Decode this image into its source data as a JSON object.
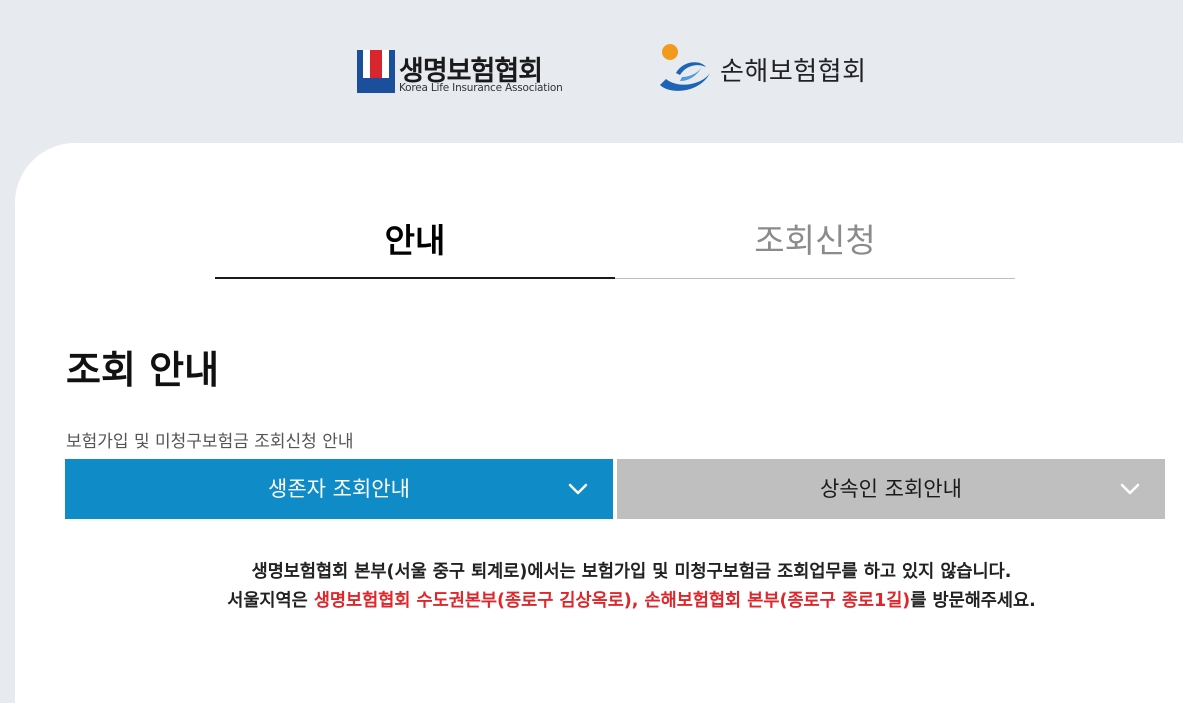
{
  "header": {
    "life_association": {
      "name": "생명보험협회",
      "subtitle": "Korea Life Insurance Association",
      "colors": {
        "blue": "#1b4e9b",
        "red": "#d7262e"
      }
    },
    "general_association": {
      "name": "손해보험협회",
      "colors": {
        "blue": "#1d64b4",
        "orange": "#f29a1c"
      }
    }
  },
  "tabs": [
    {
      "label": "안내",
      "active": true
    },
    {
      "label": "조회신청",
      "active": false
    }
  ],
  "main": {
    "title": "조회 안내",
    "subtitle": "보험가입 및 미청구보험금 조회신청 안내",
    "selectors": [
      {
        "label": "생존자 조회안내",
        "active": true,
        "icon": "chevron-down-icon",
        "color": "#0f8bc8"
      },
      {
        "label": "상속인 조회안내",
        "active": false,
        "icon": "chevron-down-icon",
        "color": "#bfbfbf"
      }
    ],
    "notice": {
      "line1": "생명보험협회 본부(서울 중구 퇴계로)에서는 보험가입 및 미청구보험금 조회업무를 하고 있지 않습니다.",
      "line2_prefix": "서울지역은 ",
      "line2_highlight": "생명보험협회 수도권본부(종로구 김상옥로), 손해보험협회 본부(종로구 종로1길)",
      "line2_suffix": "를 방문해주세요.",
      "highlight_color": "#e0262b"
    }
  }
}
